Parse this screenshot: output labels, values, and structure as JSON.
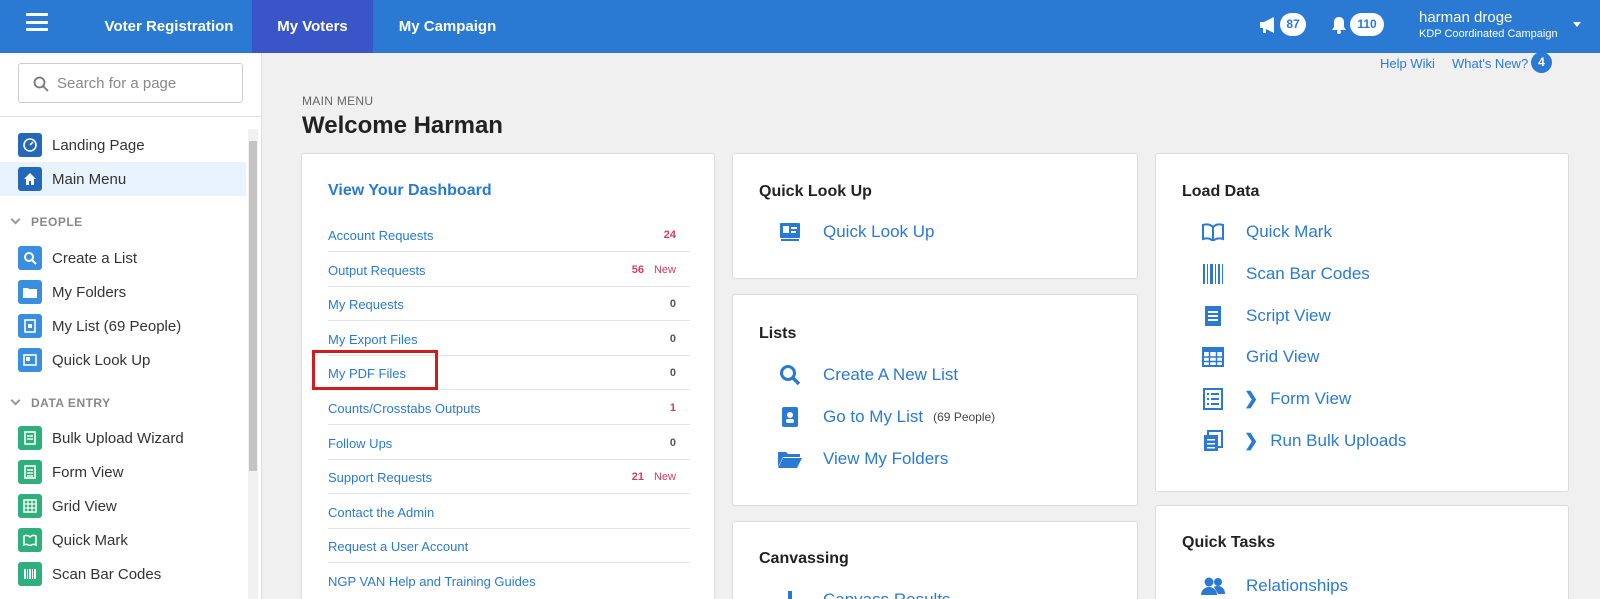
{
  "topbar": {
    "tabs": [
      {
        "label": "Voter Registration"
      },
      {
        "label": "My Voters"
      },
      {
        "label": "My Campaign"
      }
    ],
    "announcements_count": "87",
    "notifications_count": "110",
    "user_name": "harman droge",
    "user_org": "KDP Coordinated Campaign"
  },
  "sidebar": {
    "search_placeholder": "Search for a page",
    "items_top": [
      {
        "label": "Landing Page",
        "icon": "dashboard-icon"
      },
      {
        "label": "Main Menu",
        "icon": "home-icon"
      }
    ],
    "section_people": "PEOPLE",
    "people": [
      {
        "label": "Create a List",
        "icon": "search-icon"
      },
      {
        "label": "My Folders",
        "icon": "folder-icon"
      },
      {
        "label": "My List (69 People)",
        "icon": "list-book-icon"
      },
      {
        "label": "Quick Look Up",
        "icon": "id-card-icon"
      }
    ],
    "section_data_entry": "DATA ENTRY",
    "data_entry": [
      {
        "label": "Bulk Upload Wizard",
        "icon": "stack-icon"
      },
      {
        "label": "Form View",
        "icon": "form-icon"
      },
      {
        "label": "Grid View",
        "icon": "grid-icon"
      },
      {
        "label": "Quick Mark",
        "icon": "open-book-icon"
      },
      {
        "label": "Scan Bar Codes",
        "icon": "barcode-icon"
      }
    ]
  },
  "header": {
    "help_wiki": "Help Wiki",
    "whats_new": "What's New?",
    "whats_new_count": "4",
    "breadcrumb": "MAIN MENU",
    "title": "Welcome Harman"
  },
  "dashboard": {
    "title": "View Your Dashboard",
    "rows": [
      {
        "label": "Account Requests",
        "count": "24",
        "new": ""
      },
      {
        "label": "Output Requests",
        "count": "56",
        "new": "New"
      },
      {
        "label": "My Requests",
        "count": "0",
        "new": ""
      },
      {
        "label": "My Export Files",
        "count": "0",
        "new": ""
      },
      {
        "label": "My PDF Files",
        "count": "0",
        "new": ""
      },
      {
        "label": "Counts/Crosstabs Outputs",
        "count": "1",
        "new": ""
      },
      {
        "label": "Follow Ups",
        "count": "0",
        "new": ""
      },
      {
        "label": "Support Requests",
        "count": "21",
        "new": "New"
      },
      {
        "label": "Contact the Admin",
        "count": "",
        "new": ""
      },
      {
        "label": "Request a User Account",
        "count": "",
        "new": ""
      },
      {
        "label": "NGP VAN Help and Training Guides",
        "count": "",
        "new": ""
      }
    ]
  },
  "quick_look_up": {
    "title": "Quick Look Up",
    "item": "Quick Look Up"
  },
  "lists": {
    "title": "Lists",
    "create": "Create A New List",
    "goto": "Go to My List",
    "goto_sub": "(69 People)",
    "folders": "View My Folders"
  },
  "canvassing": {
    "title": "Canvassing",
    "item": "Canvass Results"
  },
  "load_data": {
    "title": "Load Data",
    "items": [
      "Quick Mark",
      "Scan Bar Codes",
      "Script View",
      "Grid View",
      "Form View",
      "Run Bulk Uploads"
    ]
  },
  "quick_tasks": {
    "title": "Quick Tasks",
    "item": "Relationships"
  },
  "colors": {
    "brand_blue": "#2a7ad4",
    "active_tab": "#3a55c8",
    "count_red": "#d03e5a",
    "highlight": "#d01c1c"
  }
}
